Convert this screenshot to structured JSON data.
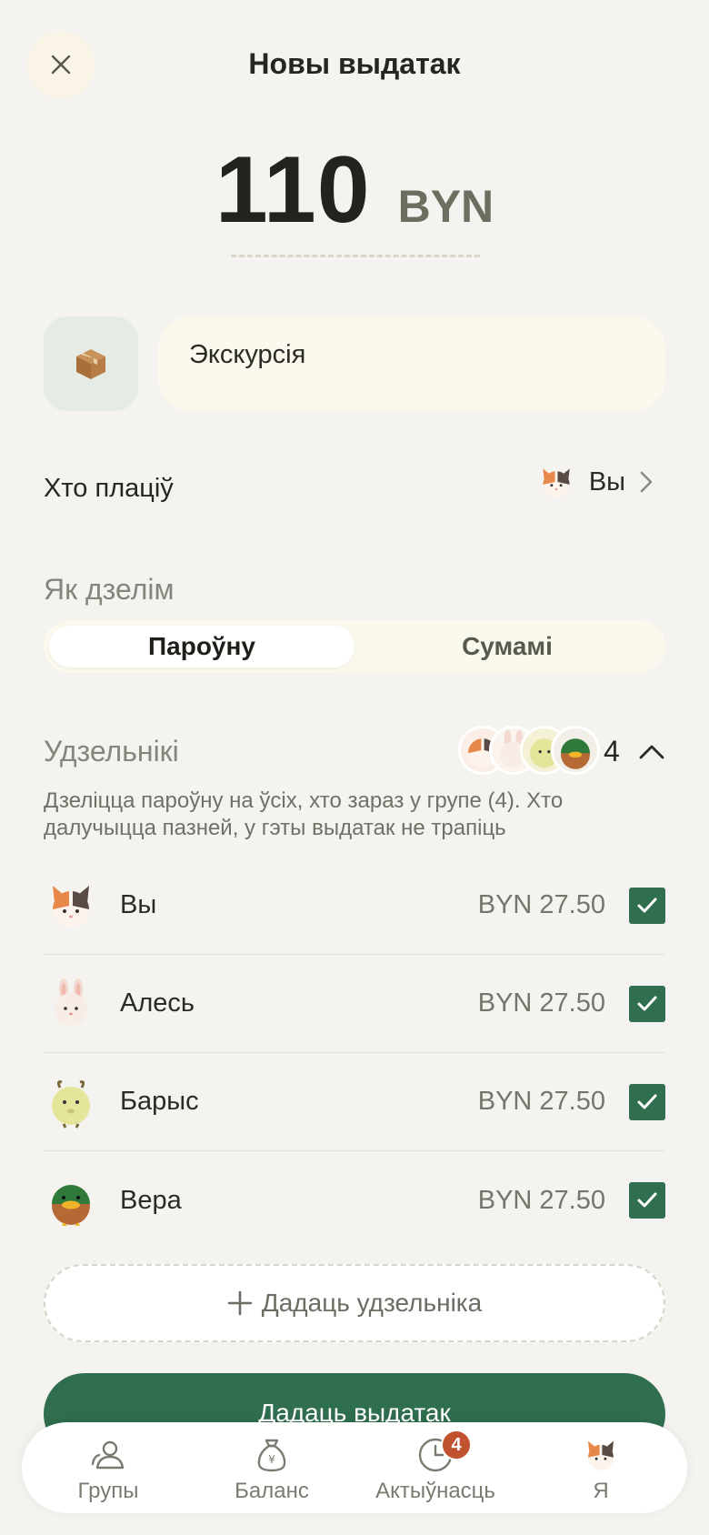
{
  "header": {
    "title": "Новы выдатак"
  },
  "amount": {
    "value": "110",
    "currency": "BYN"
  },
  "category": {
    "icon": "package-icon"
  },
  "description": {
    "value": "Экскурсія"
  },
  "payer": {
    "label": "Хто плаціў",
    "value": "Вы"
  },
  "split": {
    "title": "Як дзелім",
    "options": [
      "Пароўну",
      "Сумамі"
    ],
    "selected": "Пароўну"
  },
  "participants": {
    "title": "Удзельнікі",
    "count": "4",
    "description": "Дзеліцца пароўну на ўсіх, хто зараз у групе (4). Хто далучыцца пазней, у гэты выдатак не трапіць",
    "items": [
      {
        "name": "Вы",
        "amount": "BYN 27.50",
        "checked": true,
        "avatar": "cat-avatar"
      },
      {
        "name": "Алесь",
        "amount": "BYN 27.50",
        "checked": true,
        "avatar": "rabbit-avatar"
      },
      {
        "name": "Барыс",
        "amount": "BYN 27.50",
        "checked": true,
        "avatar": "goat-avatar"
      },
      {
        "name": "Вера",
        "amount": "BYN 27.50",
        "checked": true,
        "avatar": "duck-avatar"
      }
    ],
    "add_label": "Дадаць удзельніка"
  },
  "submit": {
    "label": "Дадаць выдатак"
  },
  "tabbar": {
    "items": [
      {
        "label": "Групы",
        "icon": "people-icon"
      },
      {
        "label": "Баланс",
        "icon": "money-bag-icon"
      },
      {
        "label": "Актыўнасць",
        "icon": "clock-icon",
        "badge": "4"
      },
      {
        "label": "Я",
        "icon": "cat-avatar"
      }
    ]
  },
  "colors": {
    "accent": "#2f6e4f",
    "badge": "#c1522f",
    "background": "#f5f3ef"
  }
}
